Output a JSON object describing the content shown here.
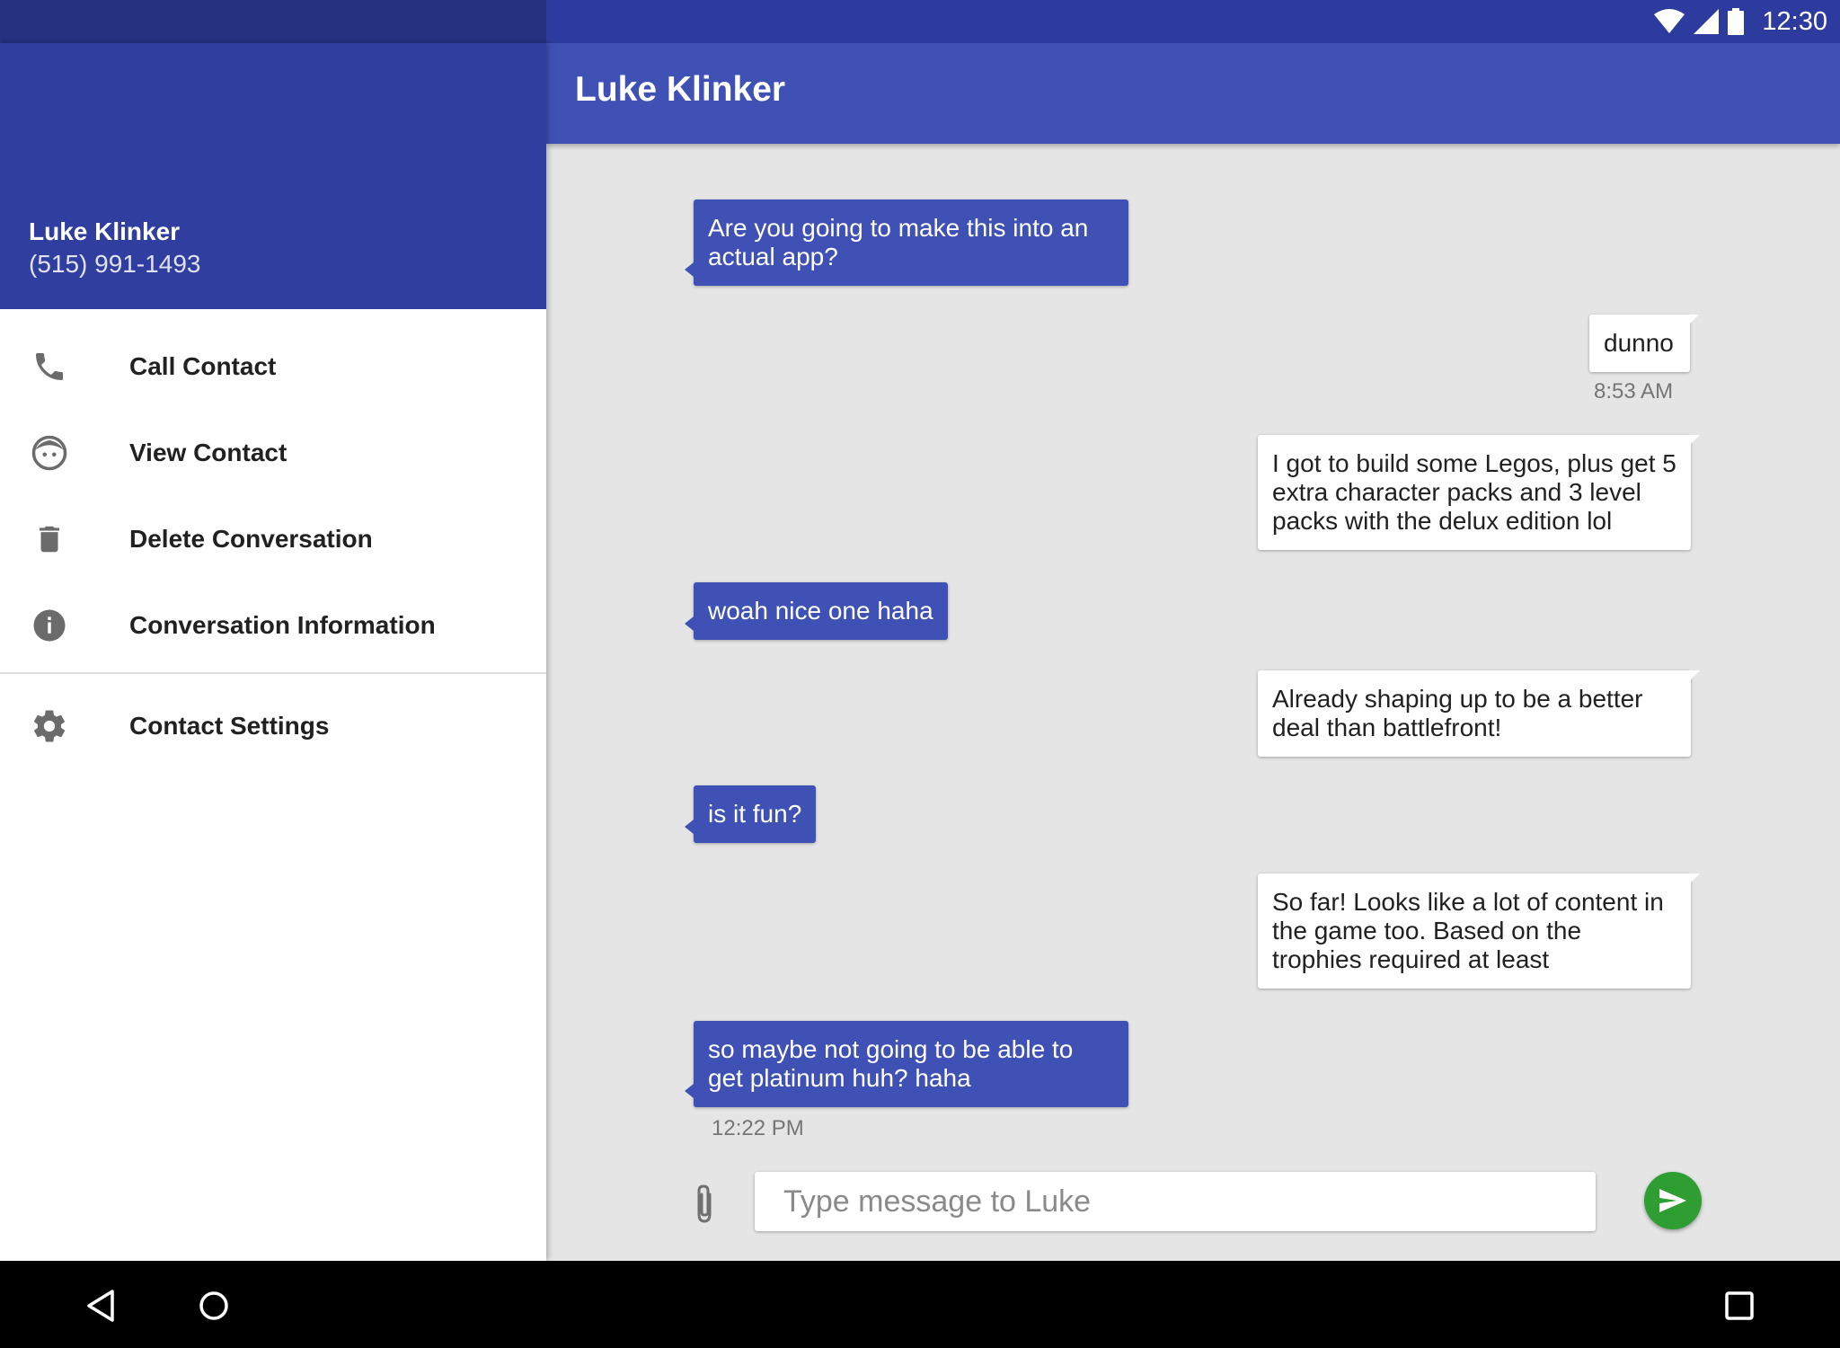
{
  "status_bar": {
    "time": "12:30",
    "icons": [
      "wifi-icon",
      "signal-icon",
      "battery-icon"
    ]
  },
  "app_bar": {
    "title": "Luke Klinker"
  },
  "drawer": {
    "header": {
      "name": "Luke Klinker",
      "number": "(515) 991-1493"
    },
    "items": [
      {
        "label": "Call Contact",
        "icon": "phone-icon"
      },
      {
        "label": "View Contact",
        "icon": "face-icon"
      },
      {
        "label": "Delete Conversation",
        "icon": "delete-icon"
      },
      {
        "label": "Conversation Information",
        "icon": "info-icon"
      },
      {
        "label": "Contact Settings",
        "icon": "gear-icon"
      }
    ]
  },
  "messages": [
    {
      "direction": "in",
      "text": "Are you going to make this into an actual app?"
    },
    {
      "direction": "out",
      "text": "dunno",
      "time": "8:53 AM"
    },
    {
      "direction": "out",
      "text": "I got to build some Legos, plus get 5 extra character packs and 3 level packs with the delux edition lol"
    },
    {
      "direction": "in",
      "text": "woah nice one haha"
    },
    {
      "direction": "out",
      "text": "Already shaping up to be a better deal than battlefront!"
    },
    {
      "direction": "in",
      "text": "is it fun?"
    },
    {
      "direction": "out",
      "text": "So far! Looks like a lot of content in the game too. Based on the trophies required at least"
    },
    {
      "direction": "in",
      "text": "so maybe not going to be able to get platinum huh? haha",
      "time": "12:22 PM"
    }
  ],
  "compose": {
    "placeholder": "Type message to Luke",
    "value": ""
  },
  "colors": {
    "primary": "#3f51b5",
    "primary_dark": "#303f9f",
    "send": "#2e9e32",
    "background": "#e5e5e5"
  }
}
